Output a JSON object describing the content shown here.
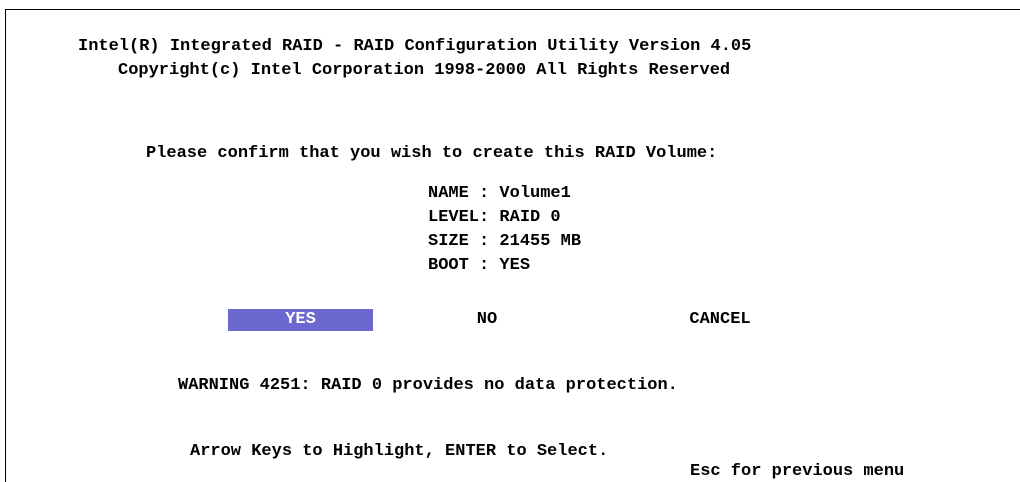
{
  "header": {
    "title": "Intel(R) Integrated RAID - RAID Configuration Utility Version 4.05",
    "copyright": "Copyright(c) Intel Corporation 1998-2000 All Rights Reserved"
  },
  "dialog": {
    "prompt": "Please confirm that you wish to create this RAID Volume:",
    "details": {
      "name": "NAME : Volume1",
      "level": "LEVEL: RAID 0",
      "size": "SIZE : 21455 MB",
      "boot": "BOOT : YES"
    },
    "buttons": {
      "yes": "YES",
      "no": "NO",
      "cancel": "CANCEL",
      "selected": "yes"
    },
    "warning": "WARNING 4251: RAID 0 provides no data protection."
  },
  "footer": {
    "hint": "Arrow Keys to Highlight, ENTER to Select.",
    "esc": "Esc for previous menu"
  },
  "colors": {
    "highlight_bg": "#6b68cf",
    "highlight_fg": "#ffffff",
    "text": "#000000",
    "background": "#ffffff"
  }
}
